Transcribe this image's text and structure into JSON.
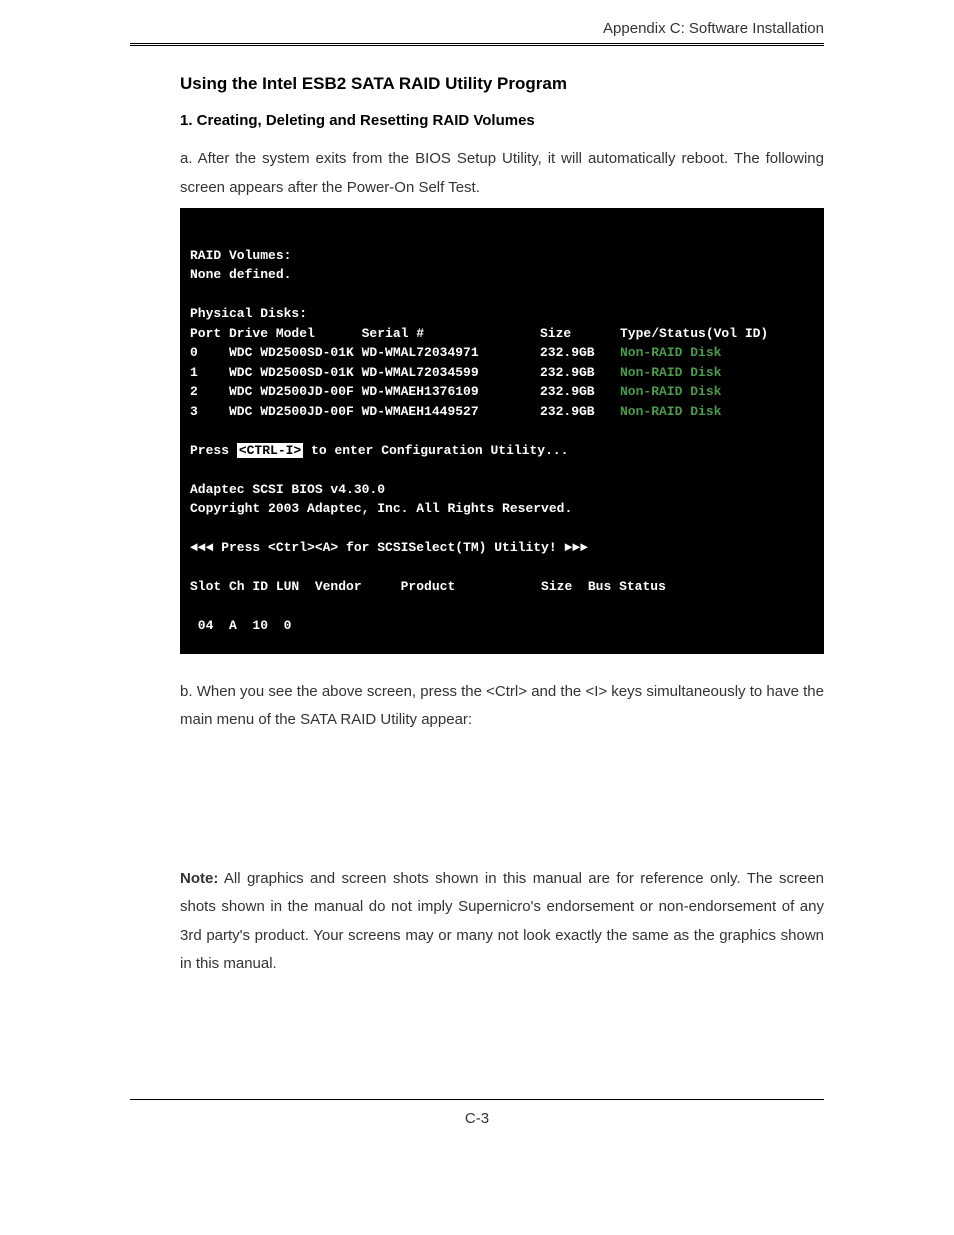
{
  "header": {
    "title": "Appendix C: Software Installation"
  },
  "headings": {
    "section": "Using the Intel ESB2 SATA RAID Utility Program",
    "sub": "1. Creating, Deleting and Resetting RAID Volumes"
  },
  "paragraphs": {
    "a": "a. After the system exits from the BIOS Setup Utility, it will automatically reboot. The following screen appears after the Power-On Self Test.",
    "b": "b. When you see the above screen, press the <Ctrl> and the <I> keys simultaneously to have the main menu of the SATA RAID Utility appear:",
    "note_label": "Note:",
    "note_body": " All graphics and screen shots shown in this manual are for reference only.  The screen shots shown in the manual do not imply Supernicro's endorsement or non-endorsement of any 3rd party's product.  Your screens may or many not look exactly the same as the graphics shown in this manual."
  },
  "terminal": {
    "raid_volumes_label": "RAID Volumes:",
    "none_defined": "None defined.",
    "physical_disks_label": "Physical Disks:",
    "disk_header_left": "Port Drive Model      Serial #",
    "disk_header_size": "Size",
    "disk_header_type": "Type/Status(Vol ID)",
    "disks": [
      {
        "port": "0",
        "model": "WDC WD2500SD-01K WD-WMAL72034971",
        "size": "232.9GB",
        "status": "Non-RAID Disk"
      },
      {
        "port": "1",
        "model": "WDC WD2500SD-01K WD-WMAL72034599",
        "size": "232.9GB",
        "status": "Non-RAID Disk"
      },
      {
        "port": "2",
        "model": "WDC WD2500JD-00F WD-WMAEH1376109",
        "size": "232.9GB",
        "status": "Non-RAID Disk"
      },
      {
        "port": "3",
        "model": "WDC WD2500JD-00F WD-WMAEH1449527",
        "size": "232.9GB",
        "status": "Non-RAID Disk"
      }
    ],
    "press_prefix": "Press ",
    "ctrl_i": "<CTRL-I>",
    "press_suffix": " to enter Configuration Utility...",
    "adaptec_bios": "Adaptec SCSI BIOS v4.30.0",
    "copyright": "Copyright 2003 Adaptec, Inc. All Rights Reserved.",
    "scsiselect_line": "◄◄◄ Press <Ctrl><A> for SCSISelect(TM) Utility! ►►►",
    "slot_header": "Slot Ch ID LUN  Vendor     Product           Size  Bus Status",
    "slot_row": " 04  A  10  0"
  },
  "footer": {
    "page_number": "C-3"
  }
}
